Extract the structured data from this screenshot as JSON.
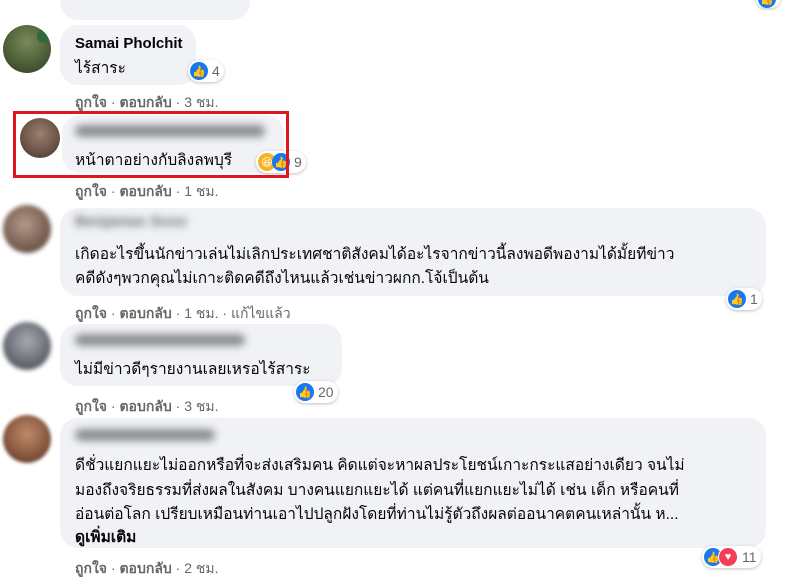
{
  "comments": [
    {
      "name": "Samai Pholchit",
      "text": [
        "ไร้สาระ"
      ],
      "actions": {
        "like": "ถูกใจ",
        "reply": "ตอบกลับ",
        "time": "3 ชม."
      },
      "reactions": {
        "count": "4",
        "icons": [
          "like-icon"
        ]
      }
    },
    {
      "name": "",
      "text": [
        "หน้าตาอย่างกับลิงลพบุรี"
      ],
      "actions": {
        "like": "ถูกใจ",
        "reply": "ตอบกลับ",
        "time": "1 ชม."
      },
      "reactions": {
        "count": "9",
        "icons": [
          "haha-icon",
          "like-icon"
        ]
      }
    },
    {
      "name": "Benjamas Soso",
      "text": [
        "เกิดอะไรขึ้นนักข่าวเล่นไม่เลิกประเทศชาติสังคมได้อะไรจากข่าวนี้ลงพอดีพองามได้มั้ยทีข่าว",
        "คดีดังๆพวกคุณไม่เกาะติดคดีถึงไหนแล้วเช่นข่าวผกก.โจ้เป็นต้น"
      ],
      "actions": {
        "like": "ถูกใจ",
        "reply": "ตอบกลับ",
        "time": "1 ชม.",
        "edited": "แก้ไขแล้ว"
      },
      "reactions": {
        "count": "1",
        "icons": [
          "like-icon"
        ]
      }
    },
    {
      "name": "",
      "text": [
        "ไม่มีข่าวดีๆรายงานเลยเหรอไร้สาระ"
      ],
      "actions": {
        "like": "ถูกใจ",
        "reply": "ตอบกลับ",
        "time": "3 ชม."
      },
      "reactions": {
        "count": "20",
        "icons": [
          "like-icon"
        ]
      }
    },
    {
      "name": "",
      "text": [
        "ดีชั่วแยกแยะไม่ออกหรือที่จะส่งเสริมคน คิดแต่จะหาผลประโยชน์เกาะกระแสอย่างเดียว จนไม่",
        "มองถึงจริยธรรมที่ส่งผลในสังคม บางคนแยกแยะได้ แต่คนที่แยกแยะไม่ได้ เช่น เด็ก หรือคนที่",
        "อ่อนต่อโลก เปรียบเหมือนท่านเอาไปปลูกฝังโดยที่ท่านไม่รู้ตัวถึงผลต่ออนาคตคนเหล่านั้น ห..."
      ],
      "see_more": "ดูเพิ่มเติม",
      "actions": {
        "like": "ถูกใจ",
        "reply": "ตอบกลับ",
        "time": "2 ชม."
      },
      "reactions": {
        "count": "11",
        "icons": [
          "like-icon",
          "love-icon"
        ]
      }
    }
  ],
  "colors": {
    "highlight": "#e0161e",
    "bubble": "#f0f2f5",
    "like": "#1877f2",
    "love": "#f33e58",
    "meta": "#65676b"
  }
}
